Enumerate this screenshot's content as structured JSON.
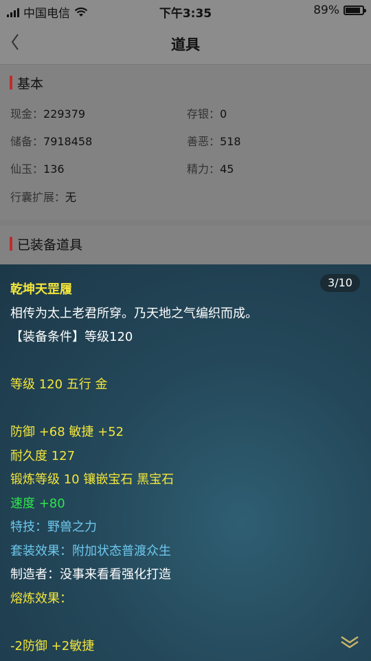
{
  "status_bar": {
    "carrier": "中国电信",
    "time": "下午3:35",
    "battery": "89%",
    "battery_level": 0.89
  },
  "nav": {
    "title": "道具",
    "back_icon": "chevron-left-icon"
  },
  "basic": {
    "title": "基本",
    "rows": [
      {
        "k": "现金：",
        "v": "229379"
      },
      {
        "k": "存银：",
        "v": "0"
      },
      {
        "k": "储备：",
        "v": "7918458"
      },
      {
        "k": "善恶：",
        "v": "518"
      },
      {
        "k": "仙玉：",
        "v": "136"
      },
      {
        "k": "精力：",
        "v": "45"
      },
      {
        "k": "行囊扩展：",
        "v": "无"
      }
    ]
  },
  "equipped": {
    "title": "已装备道具"
  },
  "popup": {
    "pager": "3/10",
    "lines": [
      "乾坤天罡履",
      "相传为太上老君所穿。乃天地之气编织而成。",
      "【装备条件】等级120",
      "等级 120 五行 金",
      "防御 +68 敏捷 +52",
      "耐久度 127",
      "锻炼等级 10 镶嵌宝石 黑宝石",
      "速度 +80",
      "特技：野兽之力",
      "套装效果：附加状态普渡众生",
      "制造者：没事来看看强化打造",
      "熔炼效果：",
      "-2防御 +2敏捷"
    ],
    "more_icon": "double-chevron-down-icon"
  },
  "colors": {
    "accent_bar": "#c02a2a",
    "yellow_text": "#f4e63a",
    "green_text": "#2de84a",
    "blue_text": "#6ec8ee"
  }
}
